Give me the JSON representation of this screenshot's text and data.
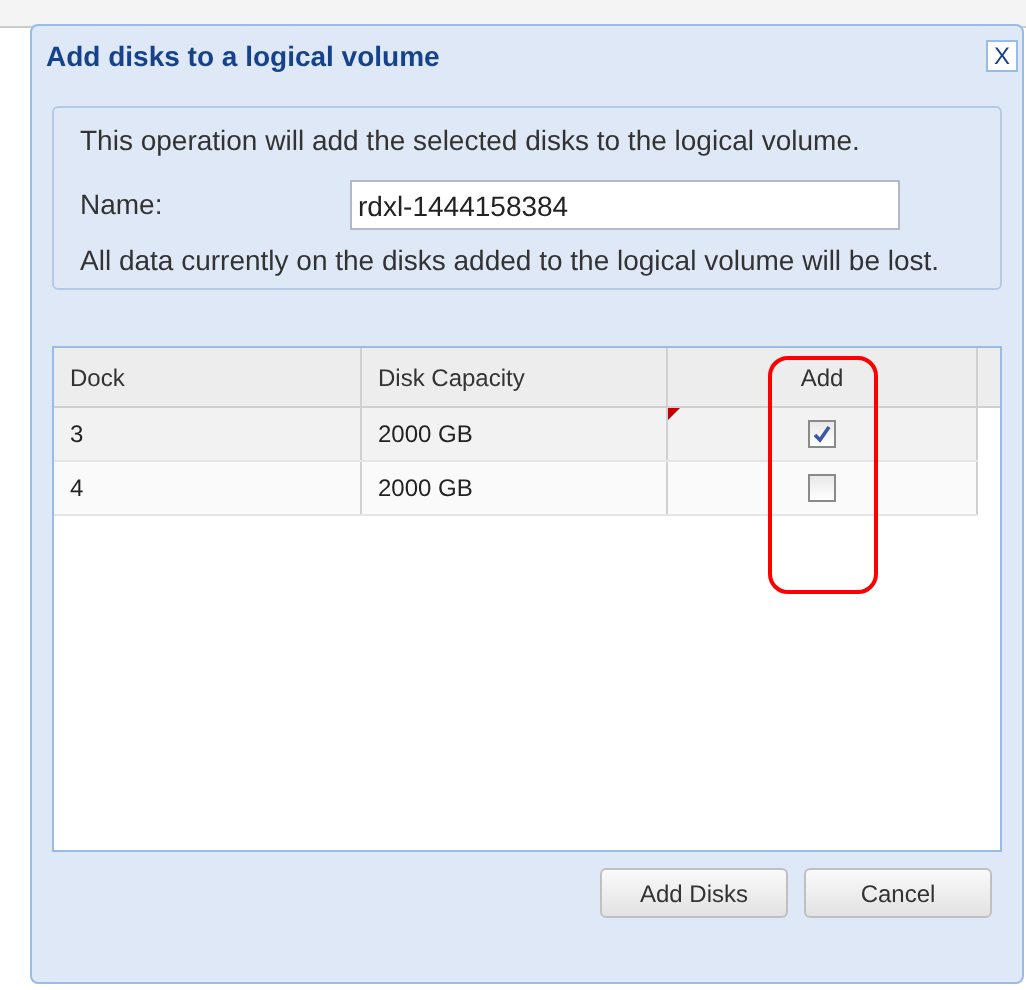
{
  "dialog": {
    "title": "Add disks to a logical volume",
    "close_glyph": "X"
  },
  "info": {
    "intro": "This operation will add the selected disks to the logical volume.",
    "name_label": "Name:",
    "name_value": "rdxl-1444158384",
    "warning": "All data currently on the disks added to the logical volume will be lost."
  },
  "table": {
    "columns": [
      "Dock",
      "Disk Capacity",
      "Add"
    ],
    "rows": [
      {
        "dock": "3",
        "capacity": "2000 GB",
        "checked": true,
        "modified": true
      },
      {
        "dock": "4",
        "capacity": "2000 GB",
        "checked": false,
        "modified": false
      }
    ]
  },
  "buttons": [
    "Add Disks",
    "Cancel"
  ]
}
